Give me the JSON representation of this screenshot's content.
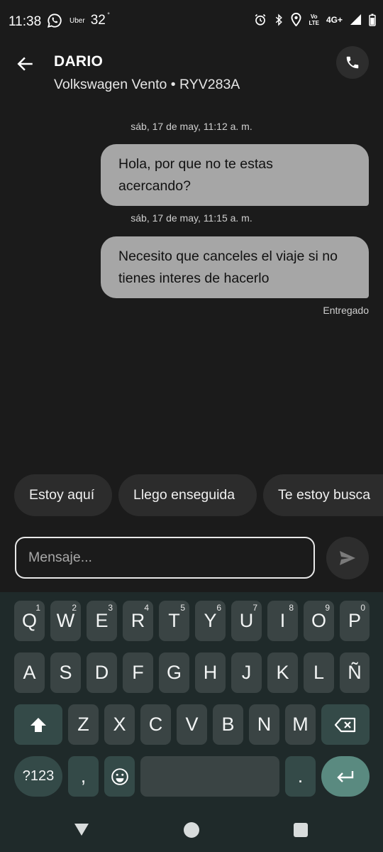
{
  "status_bar": {
    "time": "11:38",
    "uber_label": "Uber",
    "temperature": "32",
    "temperature_unit": "°",
    "volte_line1": "Vo",
    "volte_line2": "LTE",
    "network": "4G+"
  },
  "header": {
    "contact_name": "DARIO",
    "vehicle": "Volkswagen Vento • RYV283A"
  },
  "messages": [
    {
      "timestamp": "sáb, 17 de may, 11:12 a. m.",
      "line1": "Hola, por que no te estas",
      "line2": "acercando?"
    },
    {
      "timestamp": "sáb, 17 de may, 11:15 a. m.",
      "line1": "Necesito que canceles el viaje si no",
      "line2": "tienes interes de hacerlo"
    }
  ],
  "delivery_status": "Entregado",
  "quick_replies": [
    "Estoy aquí",
    "Llego enseguida",
    "Te estoy busca"
  ],
  "composer": {
    "placeholder": "Mensaje..."
  },
  "keyboard": {
    "row1": [
      {
        "key": "Q",
        "hint": "1"
      },
      {
        "key": "W",
        "hint": "2"
      },
      {
        "key": "E",
        "hint": "3"
      },
      {
        "key": "R",
        "hint": "4"
      },
      {
        "key": "T",
        "hint": "5"
      },
      {
        "key": "Y",
        "hint": "6"
      },
      {
        "key": "U",
        "hint": "7"
      },
      {
        "key": "I",
        "hint": "8"
      },
      {
        "key": "O",
        "hint": "9"
      },
      {
        "key": "P",
        "hint": "0"
      }
    ],
    "row2": [
      "A",
      "S",
      "D",
      "F",
      "G",
      "H",
      "J",
      "K",
      "L",
      "Ñ"
    ],
    "row3": [
      "Z",
      "X",
      "C",
      "V",
      "B",
      "N",
      "M"
    ],
    "symbols_key": "?123",
    "comma_key": ",",
    "period_key": "."
  },
  "colors": {
    "background": "#1b1b1b",
    "bubble": "#a6a6a6",
    "keyboard_bg": "#1f2a2a",
    "key": "#3a4444",
    "accent": "#5a8a80"
  }
}
